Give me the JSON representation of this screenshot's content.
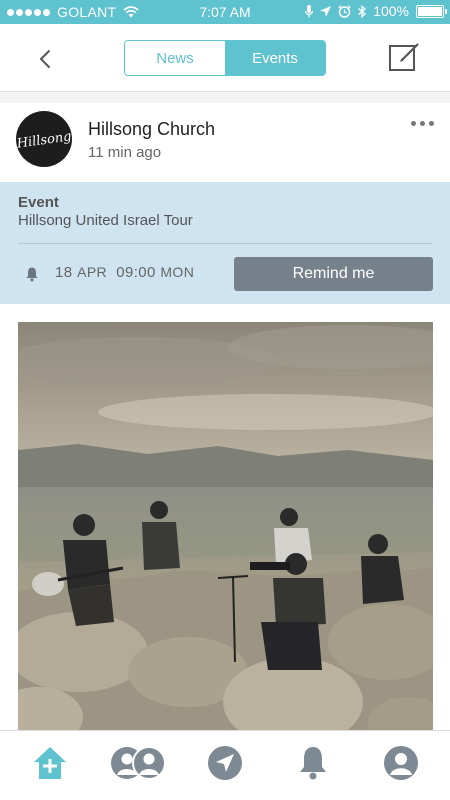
{
  "status_bar": {
    "carrier": "GOLANT",
    "time": "7:07 AM",
    "battery": "100%"
  },
  "header": {
    "tabs": [
      {
        "label": "News",
        "selected": false
      },
      {
        "label": "Events",
        "selected": true
      }
    ]
  },
  "post": {
    "author": "Hillsong Church",
    "timestamp": "11 min ago",
    "avatar_logo_text": "Hillsong",
    "event": {
      "heading": "Event",
      "title": "Hillsong United Israel Tour",
      "day": "18",
      "month": "APR",
      "time": "09:00",
      "weekday": "MON",
      "remind_label": "Remind me"
    }
  },
  "colors": {
    "accent": "#5fc2cf",
    "event_panel": "#cfe3f1",
    "remind_button": "#76818b",
    "tab_icon": "#7d8a93"
  },
  "icons": {
    "back": "chevron-left-icon",
    "compose": "compose-icon",
    "more": "more-dots-icon",
    "bell": "bell-icon",
    "tabs": [
      "home-icon",
      "groups-icon",
      "location-arrow-icon",
      "notifications-icon",
      "profile-icon"
    ]
  }
}
